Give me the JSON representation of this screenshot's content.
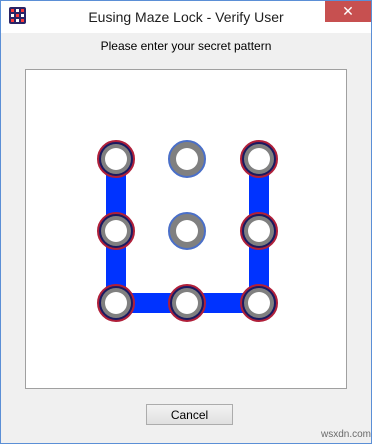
{
  "window": {
    "title": "Eusing Maze Lock - Verify User",
    "close_label": "✕"
  },
  "prompt": "Please enter your secret pattern",
  "pattern": {
    "grid": {
      "rows": 3,
      "cols": 3
    },
    "nodes": [
      {
        "id": "r1c1",
        "row": 1,
        "col": 1,
        "selected": true
      },
      {
        "id": "r1c2",
        "row": 1,
        "col": 2,
        "selected": false
      },
      {
        "id": "r1c3",
        "row": 1,
        "col": 3,
        "selected": true
      },
      {
        "id": "r2c1",
        "row": 2,
        "col": 1,
        "selected": true
      },
      {
        "id": "r2c2",
        "row": 2,
        "col": 2,
        "selected": false
      },
      {
        "id": "r2c3",
        "row": 2,
        "col": 3,
        "selected": true
      },
      {
        "id": "r3c1",
        "row": 3,
        "col": 1,
        "selected": true
      },
      {
        "id": "r3c2",
        "row": 3,
        "col": 2,
        "selected": true
      },
      {
        "id": "r3c3",
        "row": 3,
        "col": 3,
        "selected": true
      }
    ],
    "path": [
      "r1c1",
      "r2c1",
      "r3c1",
      "r3c2",
      "r3c3",
      "r2c3",
      "r1c3"
    ],
    "colors": {
      "line": "#0033ff",
      "selected_ring": "#b0203a",
      "unselected_ring": "#4a6fc8",
      "node_body": "#808080",
      "node_center": "#ffffff",
      "selected_inner": "#1a1a60"
    }
  },
  "buttons": {
    "cancel_label": "Cancel"
  },
  "watermark": "wsxdn.com",
  "app_icon": {
    "colors": [
      "#ff3a3a",
      "#ffffff",
      "#ff3a3a",
      "#ffffff",
      "#ff3a3a",
      "#ffffff",
      "#ff3a3a",
      "#ffffff",
      "#ff3a3a"
    ]
  }
}
